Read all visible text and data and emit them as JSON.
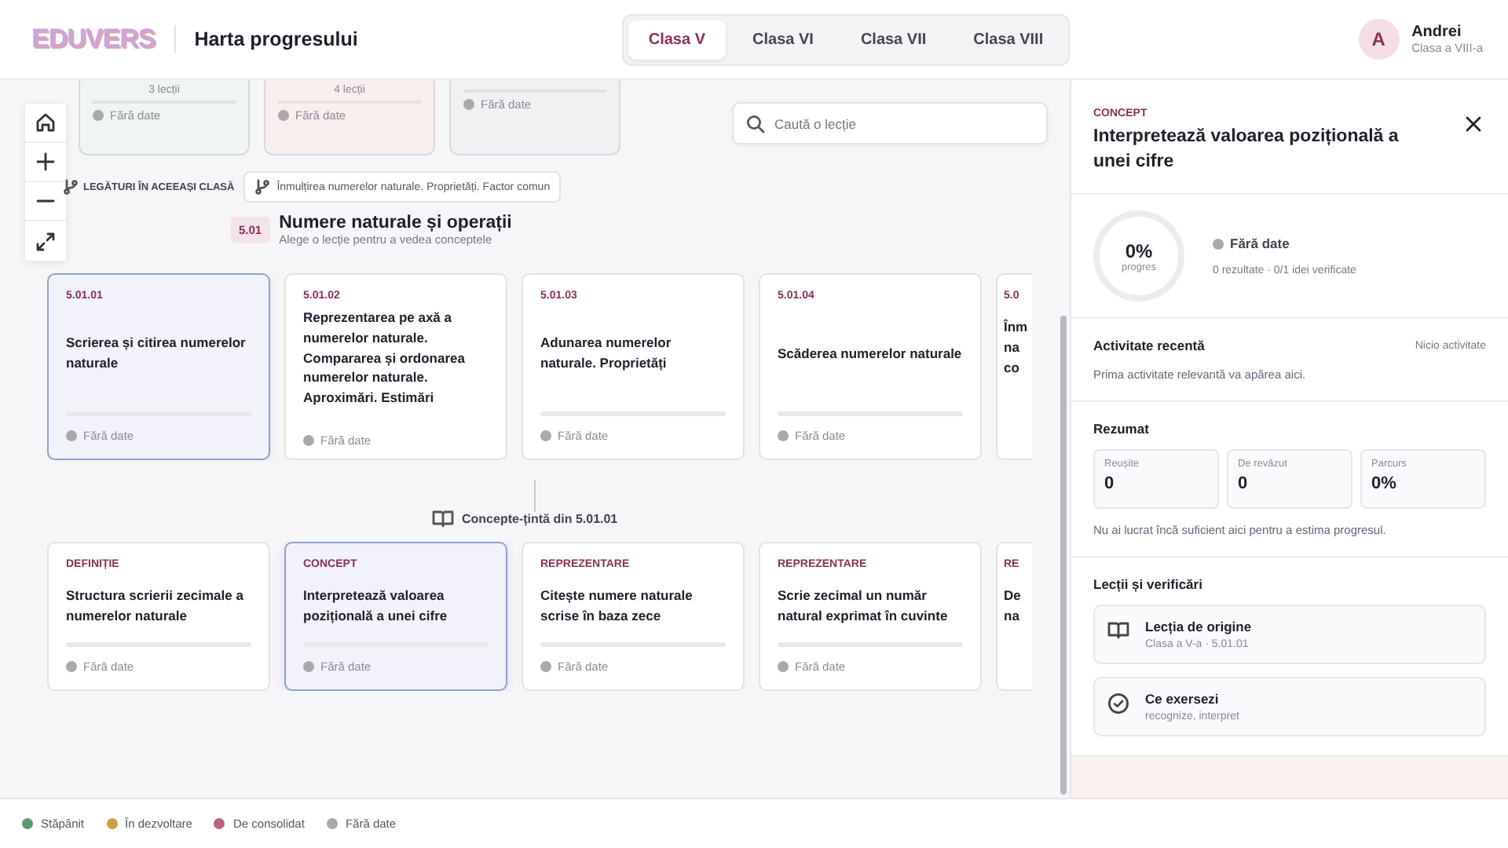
{
  "header": {
    "logo": "EDUVERS",
    "title": "Harta progresului",
    "tabs": [
      {
        "label": "Clasa V",
        "selected": true
      },
      {
        "label": "Clasa VI",
        "selected": false
      },
      {
        "label": "Clasa VII",
        "selected": false
      },
      {
        "label": "Clasa VIII",
        "selected": false
      }
    ],
    "user": {
      "initial": "A",
      "name": "Andrei",
      "grade": "Clasa a VIII-a"
    }
  },
  "canvas": {
    "top_cards": [
      {
        "color": "#eef5f3",
        "count": "3 lecții",
        "status": "Fără date"
      },
      {
        "color": "#fbeeee",
        "count": "4 lecții",
        "status": "Fără date"
      },
      {
        "color": "#f1f1f4",
        "status": "Fără date"
      }
    ],
    "search": {
      "placeholder": "Caută o lecție"
    },
    "links": {
      "label": "LEGĂTURI ÎN ACEEAȘI CLASĂ",
      "chips": [
        "Înmulțirea numerelor naturale. Proprietăți. Factor comun"
      ]
    },
    "unit": {
      "code": "5.01",
      "title": "Numere naturale și operații",
      "subtitle": "Alege o lecție pentru a vedea conceptele"
    },
    "lessons": [
      {
        "code": "5.01.01",
        "title": "Scrierea și citirea numerelor naturale",
        "status": "Fără date",
        "selected": true
      },
      {
        "code": "5.01.02",
        "title": "Reprezentarea pe axă a numerelor naturale. Compararea și ordonarea numerelor naturale. Aproximări. Estimări",
        "status": "Fără date",
        "selected": false
      },
      {
        "code": "5.01.03",
        "title": "Adunarea numerelor naturale. Proprietăți",
        "status": "Fără date",
        "selected": false
      },
      {
        "code": "5.01.04",
        "title": "Scăderea numerelor naturale",
        "status": "Fără date",
        "selected": false
      },
      {
        "code": "5.0",
        "title": "Înm na co",
        "selected": false
      }
    ],
    "concepts_label": "Concepte-țintă din 5.01.01",
    "concepts": [
      {
        "kind": "DEFINIȚIE",
        "title": "Structura scrierii zecimale a numerelor naturale",
        "status": "Fără date",
        "selected": false
      },
      {
        "kind": "CONCEPT",
        "title": "Interpretează valoarea pozițională a unei cifre",
        "status": "Fără date",
        "selected": true
      },
      {
        "kind": "REPREZENTARE",
        "title": "Citește numere naturale scrise în baza zece",
        "status": "Fără date",
        "selected": false
      },
      {
        "kind": "REPREZENTARE",
        "title": "Scrie zecimal un număr natural exprimat în cuvinte",
        "status": "Fără date",
        "selected": false
      },
      {
        "kind": "RE",
        "title": "De na",
        "selected": false
      }
    ]
  },
  "panel": {
    "kind": "CONCEPT",
    "title": "Interpretează valoarea pozițională a unei cifre",
    "progress": {
      "value": "0%",
      "label": "progres",
      "status": "Fără date",
      "detail": "0 rezultate · 0/1 idei verificate"
    },
    "recent": {
      "title": "Activitate recentă",
      "note": "Nicio activitate",
      "text": "Prima activitate relevantă va apărea aici."
    },
    "summary": {
      "title": "Rezumat",
      "stats": [
        {
          "label": "Reușite",
          "value": "0"
        },
        {
          "label": "De revăzut",
          "value": "0"
        },
        {
          "label": "Parcurs",
          "value": "0%"
        }
      ],
      "note": "Nu ai lucrat încă suficient aici pentru a estima progresul."
    },
    "lessons": {
      "title": "Lecții și verificări",
      "items": [
        {
          "kind": "origin",
          "title": "Lecția de origine",
          "subtitle": "Clasa a V-a · 5.01.01"
        },
        {
          "kind": "practice",
          "title": "Ce exersezi",
          "subtitle": "recognize, interpret"
        }
      ]
    }
  },
  "legend": [
    {
      "label": "Stăpânit",
      "color": "#5a9a72"
    },
    {
      "label": "În dezvoltare",
      "color": "#c9a040"
    },
    {
      "label": "De consolidat",
      "color": "#c0607a"
    },
    {
      "label": "Fără date",
      "color": "#a8a8ad"
    }
  ]
}
